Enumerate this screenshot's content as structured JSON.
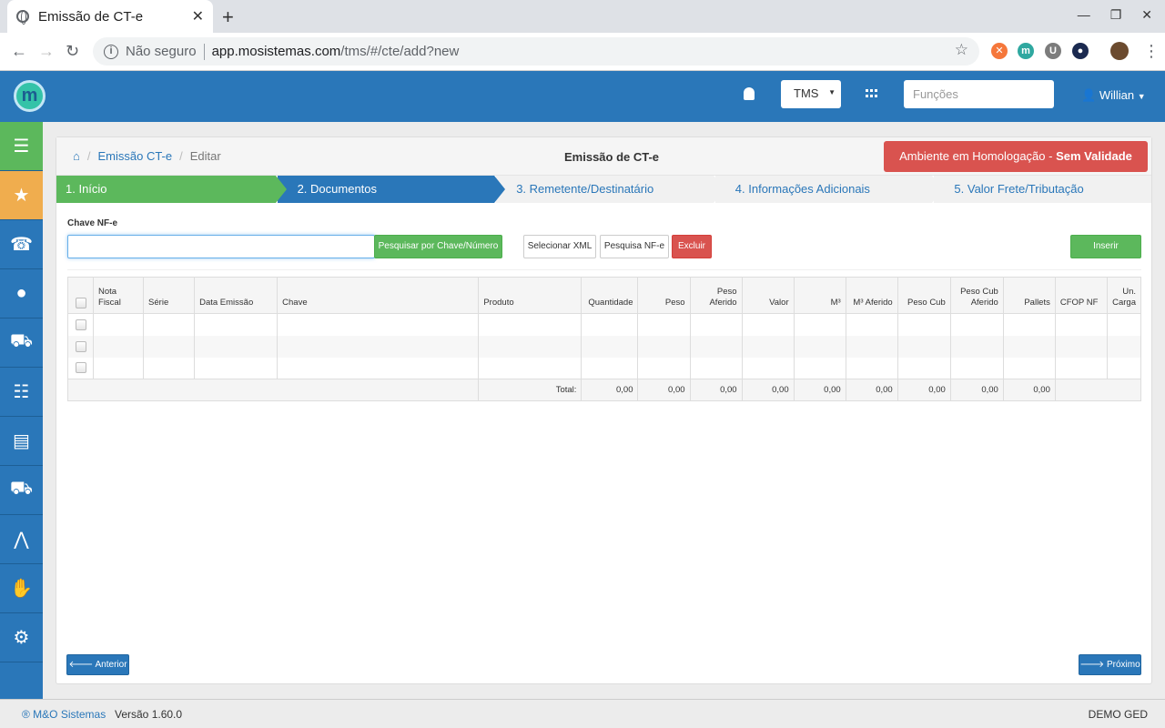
{
  "browser": {
    "tab_title": "Emissão de CT-e",
    "tab_close": "✕",
    "new_tab": "+",
    "insecure_label": "Não seguro",
    "url_host": "app.mosistemas.com",
    "url_path": "/tms/#/cte/add?new"
  },
  "header": {
    "logo_letter": "m",
    "module_select": "TMS",
    "search_placeholder": "Funções",
    "user_name": "Willian"
  },
  "breadcrumb": {
    "link": "Emissão CT-e",
    "current": "Editar"
  },
  "page_title": "Emissão de CT-e",
  "env_badge": {
    "text": "Ambiente em Homologação - ",
    "strong": "Sem Validade Fiscal"
  },
  "steps": [
    {
      "label": "1. Início",
      "state": "done"
    },
    {
      "label": "2. Documentos",
      "state": "active"
    },
    {
      "label": "3. Remetente/Destinatário",
      "state": "pending"
    },
    {
      "label": "4. Informações Adicionais",
      "state": "pending"
    },
    {
      "label": "5. Valor Frete/Tributação",
      "state": "pending"
    }
  ],
  "form": {
    "chave_label": "Chave NF-e",
    "chave_value": "",
    "btn_pesquisar": "Pesquisar por Chave/Número",
    "btn_selecionar_xml": "Selecionar XML",
    "btn_pesquisa_nfe": "Pesquisa NF-e",
    "btn_excluir": "Excluir",
    "btn_inserir": "Inserir"
  },
  "table": {
    "columns": [
      "Nota Fiscal",
      "Série",
      "Data Emissão",
      "Chave",
      "Produto",
      "Quantidade",
      "Peso",
      "Peso Aferido",
      "Valor",
      "M³",
      "M³ Aferido",
      "Peso Cub",
      "Peso Cub Aferido",
      "Pallets",
      "CFOP NF",
      "Un. Carga"
    ],
    "empty_rows": 3,
    "total_label": "Total:",
    "totals": [
      "0,00",
      "0,00",
      "0,00",
      "0,00",
      "0,00",
      "0,00",
      "0,00",
      "0,00",
      "0,00"
    ]
  },
  "nav": {
    "prev": "Anterior",
    "next": "Próximo"
  },
  "footer": {
    "brand": "® M&O Sistemas",
    "version": "Versão 1.60.0",
    "right": "DEMO GED"
  },
  "colors": {
    "primary": "#2a77b9",
    "success": "#5cb85c",
    "danger": "#d9534f",
    "warning": "#f0ad4e"
  }
}
